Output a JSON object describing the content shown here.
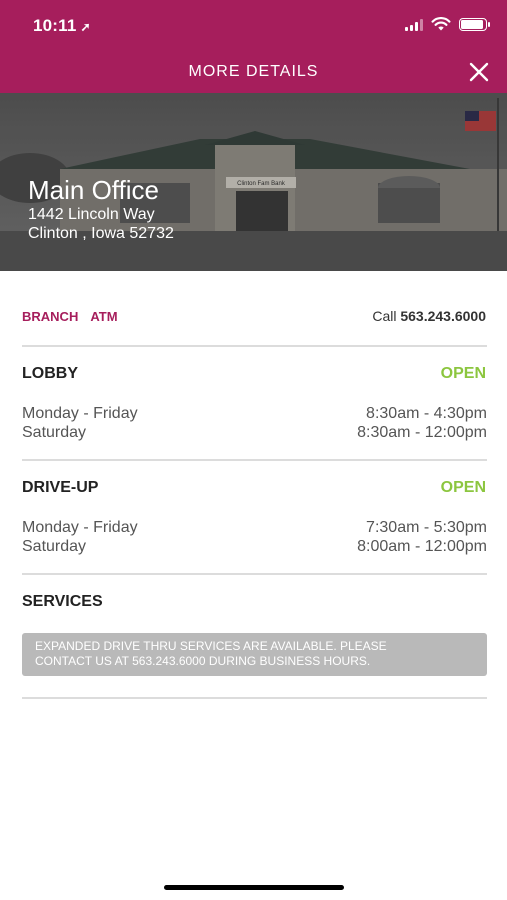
{
  "status_bar": {
    "time": "10:11",
    "location_glyph": "➚",
    "icons": [
      "signal-icon",
      "wifi-icon",
      "battery-icon"
    ]
  },
  "header": {
    "title": "MORE DETAILS",
    "close_icon": "close-icon",
    "bg_color": "#a61e5c"
  },
  "hero": {
    "name": "Main Office",
    "address_line1": "1442 Lincoln Way",
    "address_line2": "Clinton , Iowa 52732",
    "sign_text": "Clinton Fam Bank"
  },
  "tabs": {
    "branch": "BRANCH",
    "atm": "ATM"
  },
  "call": {
    "label": "Call",
    "number": "563.243.6000"
  },
  "lobby": {
    "title": "LOBBY",
    "status": "OPEN",
    "rows": [
      {
        "day": "Monday - Friday",
        "hours": "8:30am - 4:30pm"
      },
      {
        "day": "Saturday",
        "hours": "8:30am - 12:00pm"
      }
    ]
  },
  "drive_up": {
    "title": "DRIVE-UP",
    "status": "OPEN",
    "rows": [
      {
        "day": "Monday - Friday",
        "hours": "7:30am - 5:30pm"
      },
      {
        "day": "Saturday",
        "hours": "8:00am - 12:00pm"
      }
    ]
  },
  "services": {
    "title": "SERVICES",
    "notice_line1": "EXPANDED DRIVE THRU SERVICES ARE AVAILABLE. PLEASE",
    "notice_line2": "CONTACT US AT 563.243.6000 DURING BUSINESS HOURS."
  },
  "colors": {
    "accent": "#a61e5c",
    "open": "#8cc63f",
    "notice_bg": "#b9b9b9"
  }
}
